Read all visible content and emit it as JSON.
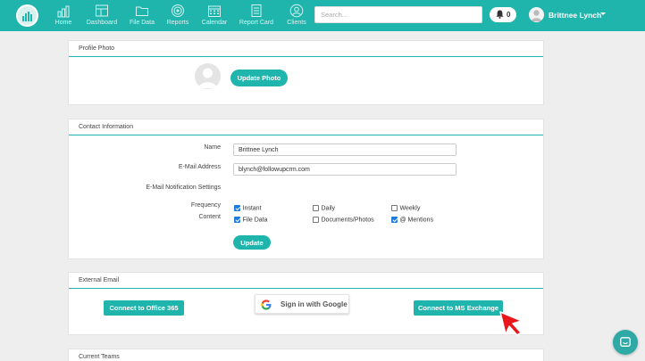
{
  "nav": {
    "items": [
      {
        "label": "Home",
        "icon": "bar-chart-icon"
      },
      {
        "label": "Dashboard",
        "icon": "dashboard-icon"
      },
      {
        "label": "File Data",
        "icon": "folder-icon"
      },
      {
        "label": "Reports",
        "icon": "target-icon"
      },
      {
        "label": "Calendar",
        "icon": "calendar-icon"
      },
      {
        "label": "Report Card",
        "icon": "report-card-icon"
      },
      {
        "label": "Clients",
        "icon": "client-icon"
      }
    ],
    "search_placeholder": "Search...",
    "notification_count": "0",
    "user_name": "Brittnee Lynch"
  },
  "profile_photo": {
    "title": "Profile Photo",
    "update_button": "Update Photo"
  },
  "contact": {
    "title": "Contact Information",
    "name_label": "Name",
    "name_value": "Brittnee Lynch",
    "email_label": "E-Mail Address",
    "email_value": "blynch@followupcrm.com",
    "notification_heading": "E-Mail Notification Settings",
    "frequency_label": "Frequency",
    "content_label": "Content",
    "frequency_options": [
      {
        "label": "Instant",
        "checked": true
      },
      {
        "label": "Daily",
        "checked": false
      },
      {
        "label": "Weekly",
        "checked": false
      }
    ],
    "content_options": [
      {
        "label": "File Data",
        "checked": true
      },
      {
        "label": "Documents/Photos",
        "checked": false
      },
      {
        "label": "@ Mentions",
        "checked": true
      }
    ],
    "update_button": "Update"
  },
  "external_email": {
    "title": "External Email",
    "office_button": "Connect to Office 365",
    "google_button": "Sign in with Google",
    "exchange_button": "Connect to MS Exchange"
  },
  "current_teams": {
    "title": "Current Teams"
  },
  "colors": {
    "brand": "#1fb5ad",
    "checkbox": "#1e7be0",
    "cursor": "#e8171b"
  }
}
